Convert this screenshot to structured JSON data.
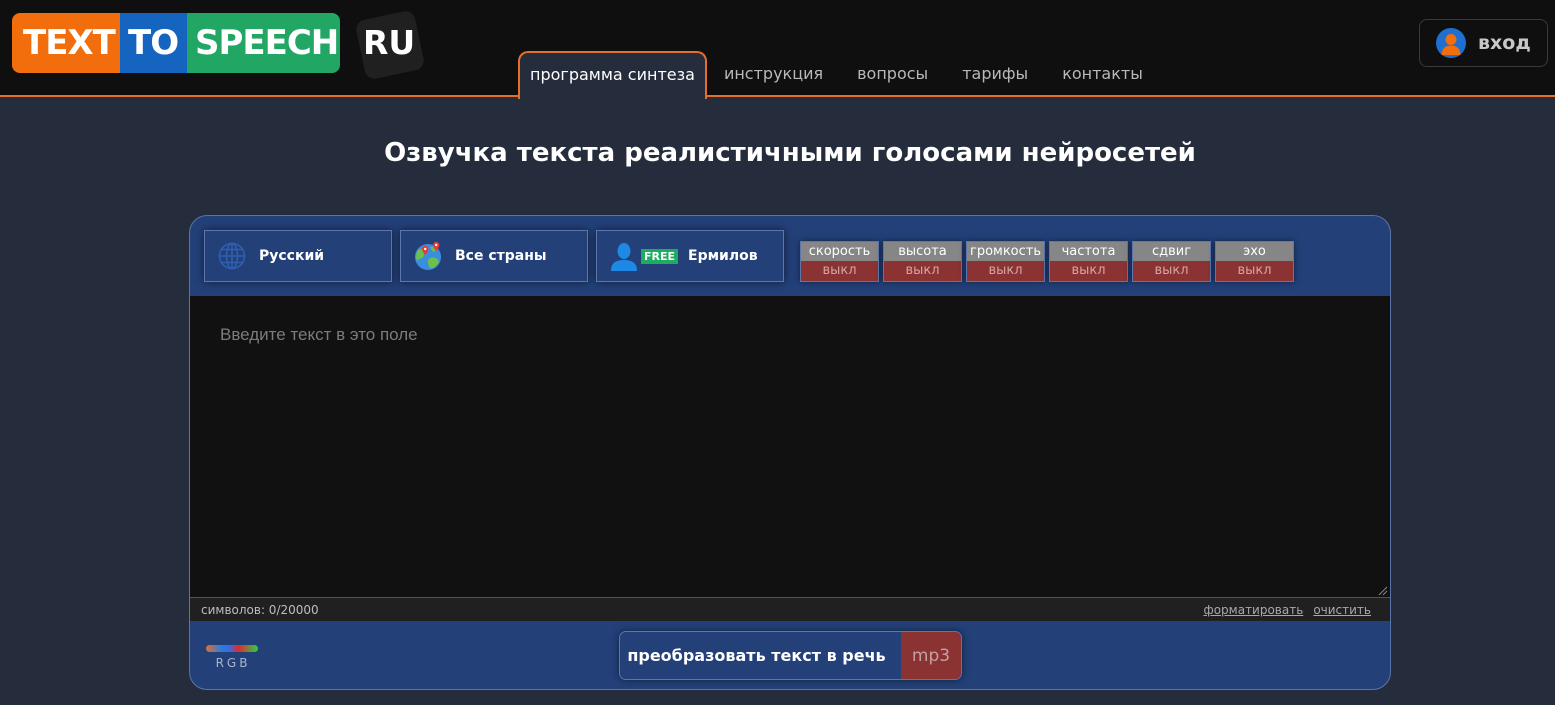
{
  "header": {
    "logo": {
      "part1": "TEXT",
      "part2": "TO",
      "part3": "SPEECH",
      "suffix": "RU"
    },
    "nav": [
      {
        "label": "программа синтеза",
        "active": true
      },
      {
        "label": "инструкция"
      },
      {
        "label": "вопросы"
      },
      {
        "label": "тарифы"
      },
      {
        "label": "контакты"
      }
    ],
    "login": {
      "label": "вход",
      "icon": "user-icon"
    }
  },
  "page": {
    "title": "Озвучка текста реалистичными голосами нейросетей"
  },
  "selectors": [
    {
      "label": "Русский",
      "icon": "globe-icon"
    },
    {
      "label": "Все страны",
      "icon": "world-map-pin-icon"
    },
    {
      "label": "Ермилов",
      "icon": "person-icon",
      "badge": "FREE"
    }
  ],
  "effects": [
    {
      "name": "скорость",
      "state": "выкл"
    },
    {
      "name": "высота",
      "state": "выкл"
    },
    {
      "name": "громкость",
      "state": "выкл"
    },
    {
      "name": "частота",
      "state": "выкл"
    },
    {
      "name": "сдвиг",
      "state": "выкл"
    },
    {
      "name": "эхо",
      "state": "выкл"
    }
  ],
  "editor": {
    "value": "",
    "placeholder": "Введите текст в это поле",
    "char_count": "символов: 0/20000",
    "format_link": "форматировать",
    "clear_link": "очистить"
  },
  "footer": {
    "rgb_label": "RGB",
    "convert_label": "преобразовать текст в речь",
    "format_label": "mp3"
  },
  "colors": {
    "accent": "#e46f2a",
    "panel": "#234079",
    "background": "#252d3c",
    "effect_off": "#8b3232"
  }
}
